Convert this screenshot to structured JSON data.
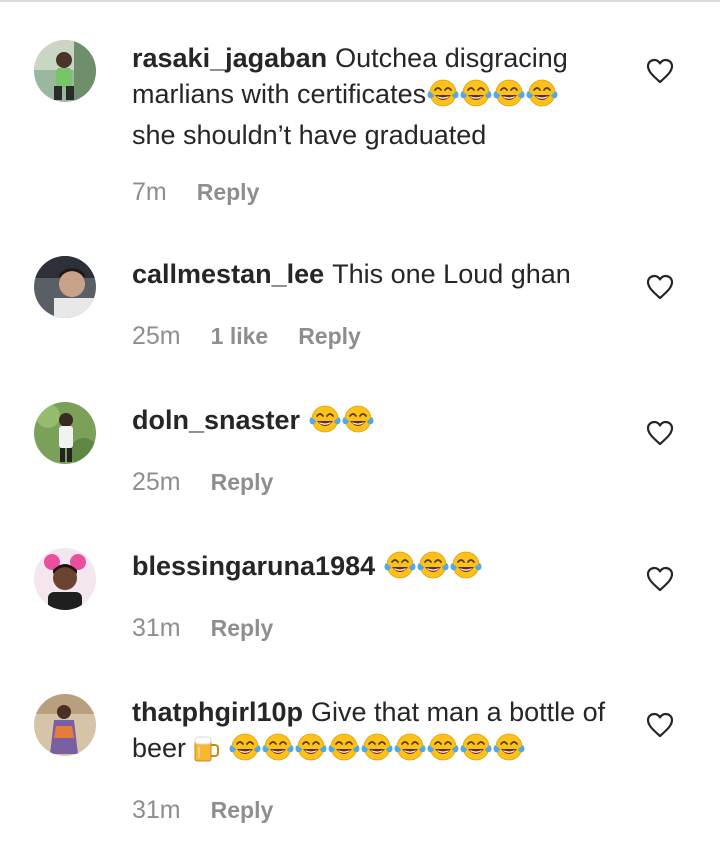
{
  "comments": [
    {
      "username": "rasaki_jagaban",
      "text_line1": "Outchea disgracing",
      "text_line2": "marlians with certificates",
      "emoji_after_line2": "😂😂😂😂",
      "text_line3": "she shouldn’t have graduated",
      "time": "7m",
      "reply": "Reply",
      "avatar_icon": "user-avatar-icon",
      "like_icon": "heart-outline-icon"
    },
    {
      "username": "callmestan_lee",
      "text_line1": "This one Loud ghan",
      "time": "25m",
      "likes": "1 like",
      "reply": "Reply",
      "avatar_icon": "user-avatar-icon",
      "like_icon": "heart-outline-icon"
    },
    {
      "username": "doln_snaster",
      "emoji": "😂😂",
      "time": "25m",
      "reply": "Reply",
      "avatar_icon": "user-avatar-icon",
      "like_icon": "heart-outline-icon"
    },
    {
      "username": "blessingaruna1984",
      "emoji": "😂😂😂",
      "time": "31m",
      "reply": "Reply",
      "avatar_icon": "user-avatar-icon",
      "like_icon": "heart-outline-icon"
    },
    {
      "username": "thatphgirl10p",
      "text_line1": "Give that man a bottle of",
      "text_line2": "beer",
      "emoji_beer": "🍺",
      "emoji": "😂😂😂😂😂😂😂😂😂",
      "time": "31m",
      "reply": "Reply",
      "avatar_icon": "user-avatar-icon",
      "like_icon": "heart-outline-icon"
    }
  ],
  "colors": {
    "text": "#262626",
    "meta": "#8e8e8e",
    "divider": "#dbdbdb",
    "emoji_face": "#fcc21b",
    "emoji_tears": "#4fa8e8"
  }
}
